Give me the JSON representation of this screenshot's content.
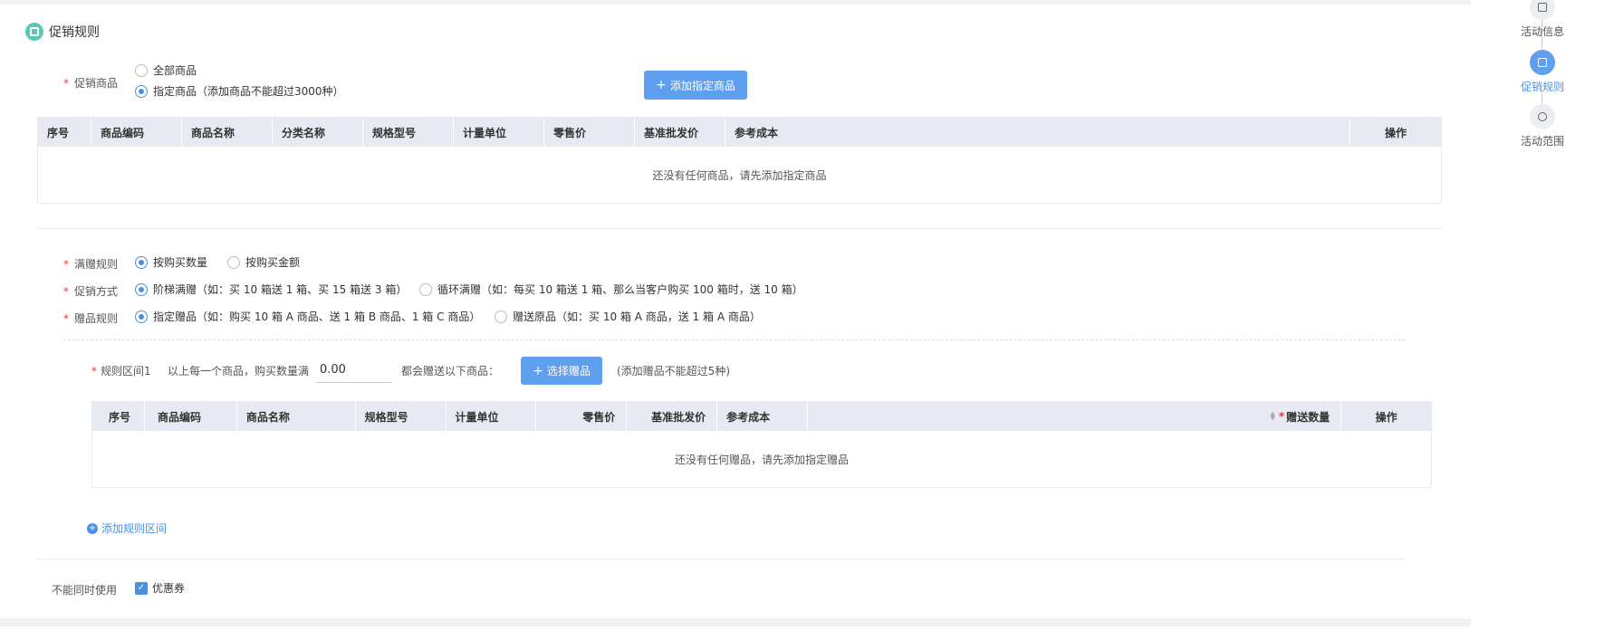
{
  "section": {
    "title": "促销规则"
  },
  "promo_goods": {
    "label": "促销商品",
    "options": [
      {
        "label": "全部商品",
        "checked": false
      },
      {
        "label": "指定商品（添加商品不能超过3000种）",
        "checked": true
      }
    ],
    "add_button": "添加指定商品",
    "table": {
      "columns": [
        "序号",
        "商品编码",
        "商品名称",
        "分类名称",
        "规格型号",
        "计量单位",
        "零售价",
        "基准批发价",
        "参考成本",
        "操作"
      ],
      "empty_text": "还没有任何商品，请先添加指定商品"
    }
  },
  "gift_rule": {
    "label": "满赠规则",
    "options": [
      {
        "label": "按购买数量",
        "checked": true
      },
      {
        "label": "按购买金额",
        "checked": false
      }
    ]
  },
  "promo_method": {
    "label": "促销方式",
    "options": [
      {
        "label": "阶梯满赠（如：买 10 箱送 1 箱、买 15 箱送 3 箱）",
        "checked": true
      },
      {
        "label": "循环满赠（如：每买 10 箱送 1 箱、那么当客户购买 100 箱时，送 10 箱）",
        "checked": false
      }
    ]
  },
  "gift_goods_rule": {
    "label": "赠品规则",
    "options": [
      {
        "label": "指定赠品（如：购买 10 箱 A 商品、送 1 箱 B 商品、1 箱 C 商品）",
        "checked": true
      },
      {
        "label": "赠送原品（如：买 10 箱 A 商品，送 1 箱 A 商品）",
        "checked": false
      }
    ]
  },
  "rule_range": {
    "label": "规则区间1",
    "text_before": "以上每一个商品，购买数量满",
    "quantity_value": "0.00",
    "text_after": "都会赠送以下商品：",
    "select_button": "选择赠品",
    "hint": "(添加赠品不能超过5种)",
    "table": {
      "columns": [
        "序号",
        "商品编码",
        "商品名称",
        "规格型号",
        "计量单位",
        "零售价",
        "基准批发价",
        "参考成本",
        "赠送数量",
        "操作"
      ],
      "empty_text": "还没有任何赠品，请先添加指定赠品"
    }
  },
  "add_range_link": "添加规则区间",
  "exclusive": {
    "label": "不能同时使用",
    "option": "优惠券",
    "checked": true
  },
  "steps": [
    {
      "label": "活动信息",
      "icon": "close-box-icon",
      "active": false
    },
    {
      "label": "促销规则",
      "icon": "upload-box-icon",
      "active": true
    },
    {
      "label": "活动范围",
      "icon": "scope-icon",
      "active": false
    }
  ],
  "colors": {
    "primary": "#5f9ff0",
    "accent_link": "#4a90e2",
    "title_icon": "#5fc8b0",
    "required": "#e53935",
    "table_header": "#e7eaf3"
  }
}
